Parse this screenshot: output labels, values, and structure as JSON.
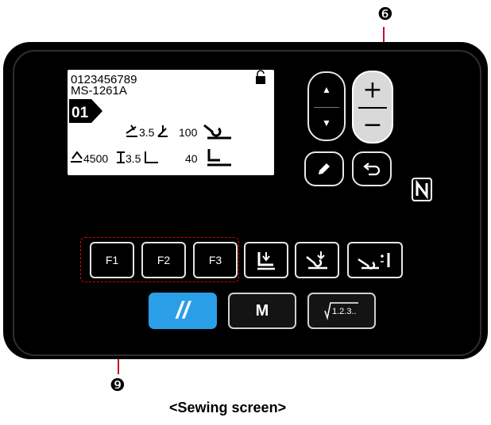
{
  "callouts": {
    "top": "❻",
    "bottom": "❾"
  },
  "lcd": {
    "line1": "0123456789",
    "line2": "MS-1261A",
    "pattern_no": "01",
    "stitch_value": "3.5",
    "speed_value": "100",
    "count_value": "4500",
    "pitch_value": "3.5",
    "foot_value": "40"
  },
  "keys": {
    "up": "▲",
    "down": "▼",
    "plus": "+",
    "minus": "−",
    "f1": "F1",
    "f2": "F2",
    "f3": "F3",
    "reset": "//",
    "mode": "M",
    "counter": "1.2.3.."
  },
  "caption": "<Sewing screen>",
  "colors": {
    "accent_blue": "#2b9ee8",
    "callout_red": "#c8102e",
    "panel": "#000000"
  }
}
